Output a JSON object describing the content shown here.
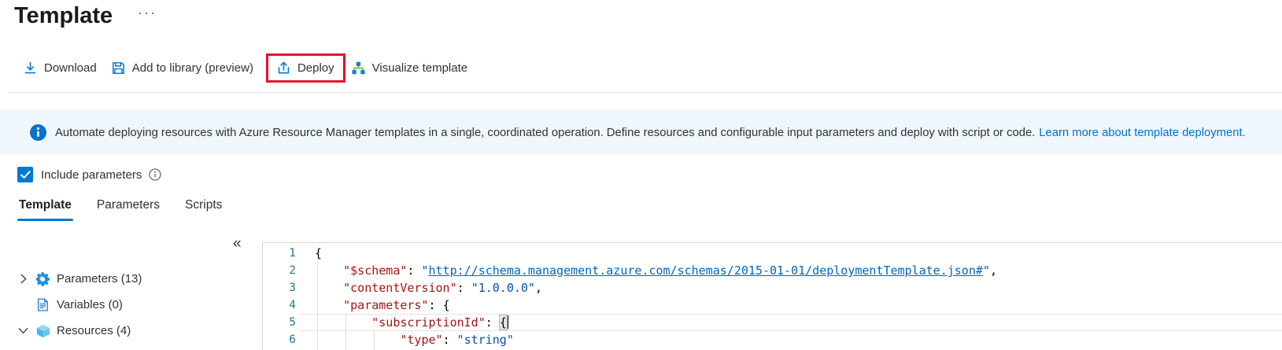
{
  "header": {
    "title": "Template",
    "menu_ellipsis": "···"
  },
  "toolbar": {
    "items": [
      {
        "name": "download",
        "label": "Download",
        "icon": "download-icon",
        "highlighted": false
      },
      {
        "name": "add-to-library",
        "label": "Add to library (preview)",
        "icon": "save-icon",
        "highlighted": false
      },
      {
        "name": "deploy",
        "label": "Deploy",
        "icon": "upload-icon",
        "highlighted": true
      },
      {
        "name": "visualize-template",
        "label": "Visualize template",
        "icon": "flowchart-icon",
        "highlighted": false
      }
    ]
  },
  "banner": {
    "icon": "info-icon",
    "text": "Automate deploying resources with Azure Resource Manager templates in a single, coordinated operation. Define resources and configurable input parameters and deploy with script or code.",
    "link_label": "Learn more about template deployment."
  },
  "options": {
    "include_parameters": {
      "label": "Include parameters",
      "checked": true,
      "info_icon": "info-outline-icon"
    }
  },
  "tabs": [
    {
      "name": "template",
      "label": "Template",
      "active": true
    },
    {
      "name": "parameters",
      "label": "Parameters",
      "active": false
    },
    {
      "name": "scripts",
      "label": "Scripts",
      "active": false
    }
  ],
  "tree": {
    "collapse_glyph": "«",
    "items": [
      {
        "name": "parameters",
        "label": "Parameters (13)",
        "expander": "chevron-right",
        "icon": "gear-icon"
      },
      {
        "name": "variables",
        "label": "Variables (0)",
        "expander": "none",
        "icon": "document-icon"
      },
      {
        "name": "resources",
        "label": "Resources (4)",
        "expander": "chevron-down",
        "icon": "cube-icon"
      }
    ]
  },
  "editor": {
    "current_line": 5,
    "colors": {
      "key": "#a31515",
      "value": "#0451a5",
      "link": "#0066bf",
      "plain": "#000000",
      "line_number": "#237893"
    },
    "lines": [
      {
        "num": 1,
        "segments": [
          {
            "c": "plain",
            "t": "{"
          }
        ]
      },
      {
        "num": 2,
        "segments": [
          {
            "c": "plain",
            "t": "    "
          },
          {
            "c": "key",
            "t": "\"$schema\""
          },
          {
            "c": "plain",
            "t": ": "
          },
          {
            "c": "value",
            "t": "\""
          },
          {
            "c": "link",
            "t": "http://schema.management.azure.com/schemas/2015-01-01/deploymentTemplate.json#"
          },
          {
            "c": "value",
            "t": "\""
          },
          {
            "c": "plain",
            "t": ","
          }
        ]
      },
      {
        "num": 3,
        "segments": [
          {
            "c": "plain",
            "t": "    "
          },
          {
            "c": "key",
            "t": "\"contentVersion\""
          },
          {
            "c": "plain",
            "t": ": "
          },
          {
            "c": "value",
            "t": "\"1.0.0.0\""
          },
          {
            "c": "plain",
            "t": ","
          }
        ]
      },
      {
        "num": 4,
        "segments": [
          {
            "c": "plain",
            "t": "    "
          },
          {
            "c": "key",
            "t": "\"parameters\""
          },
          {
            "c": "plain",
            "t": ": "
          },
          {
            "c": "plain",
            "t": "{"
          }
        ]
      },
      {
        "num": 5,
        "segments": [
          {
            "c": "plain",
            "t": "        "
          },
          {
            "c": "key",
            "t": "\"subscriptionId\""
          },
          {
            "c": "plain",
            "t": ": "
          },
          {
            "c": "bracket",
            "t": "{"
          },
          {
            "c": "caret",
            "t": ""
          }
        ]
      },
      {
        "num": 6,
        "segments": [
          {
            "c": "plain",
            "t": "            "
          },
          {
            "c": "key",
            "t": "\"type\""
          },
          {
            "c": "plain",
            "t": ": "
          },
          {
            "c": "value",
            "t": "\"string\""
          }
        ]
      }
    ]
  },
  "colors": {
    "accent": "#0078d4",
    "banner_bg": "#eff6fc",
    "highlight_red": "#e8112d",
    "link": "#0072c9"
  }
}
